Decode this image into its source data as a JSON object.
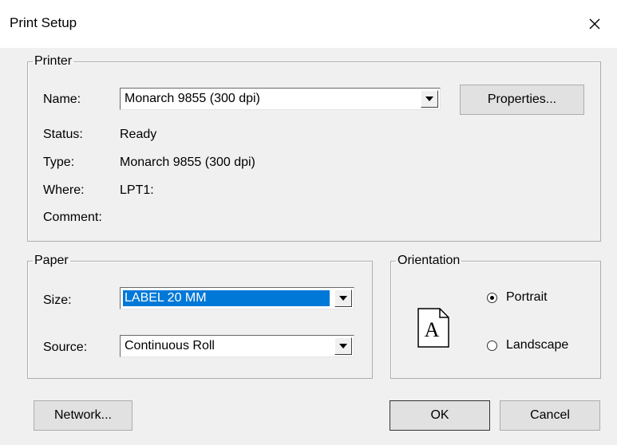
{
  "window": {
    "title": "Print Setup",
    "close_glyph": "✕"
  },
  "printer": {
    "legend": "Printer",
    "name_label": "Name:",
    "name_value": "Monarch 9855 (300 dpi)",
    "properties_label": "Properties...",
    "status_label": "Status:",
    "status_value": "Ready",
    "type_label": "Type:",
    "type_value": "Monarch 9855 (300 dpi)",
    "where_label": "Where:",
    "where_value": "LPT1:",
    "comment_label": "Comment:",
    "comment_value": ""
  },
  "paper": {
    "legend": "Paper",
    "size_label": "Size:",
    "size_value": "LABEL 20 MM",
    "source_label": "Source:",
    "source_value": "Continuous Roll"
  },
  "orientation": {
    "legend": "Orientation",
    "icon_letter": "A",
    "portrait_label": "Portrait",
    "landscape_label": "Landscape",
    "selected": "Portrait"
  },
  "buttons": {
    "network_label": "Network...",
    "ok_label": "OK",
    "cancel_label": "Cancel"
  },
  "icons": {
    "close": "close-icon",
    "dropdown": "dropdown-arrow-icon",
    "orientation_page": "portrait-page-icon"
  },
  "colors": {
    "dialog_bg": "#f0f0f0",
    "titlebar_bg": "#ffffff",
    "selection": "#0078d7",
    "button_bg": "#e1e1e1"
  }
}
